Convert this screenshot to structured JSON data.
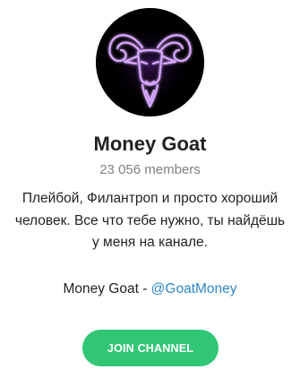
{
  "channel": {
    "avatar_icon": "goat-logo-icon",
    "title": "Money Goat",
    "members": "23 056 members",
    "description_lines": [
      "Плейбой, Филантроп и просто хороший",
      "человек. Все что тебе нужно, ты найдёшь",
      "у меня на канале."
    ],
    "contact_prefix": "Money Goat - ",
    "contact_handle": "@GoatMoney"
  },
  "actions": {
    "join_label": "JOIN CHANNEL"
  },
  "colors": {
    "join_button": "#32c777",
    "link": "#2e87ca",
    "glow": "#b65cff"
  }
}
